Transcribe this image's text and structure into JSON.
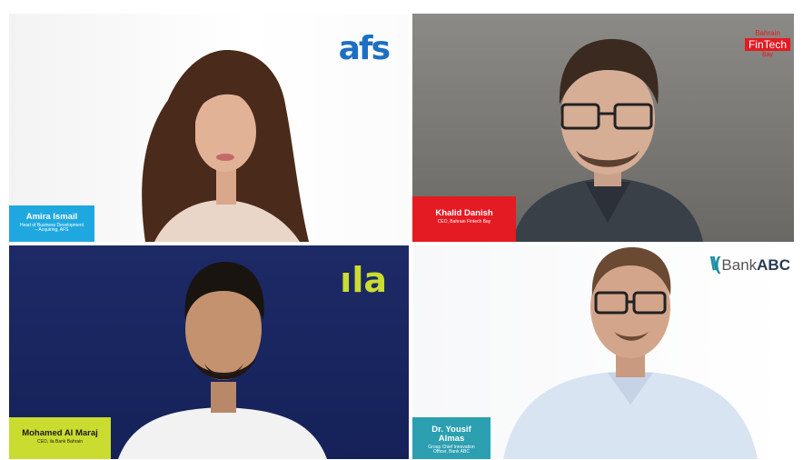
{
  "participants": [
    {
      "name": "Amira Ismail",
      "title": "Head of Business Development – Acquiring, AFS",
      "logo": "afs",
      "nameplate_color": "#1fa8e0"
    },
    {
      "name": "Khalid Danish",
      "title": "CEO, Bahrain Fintech Bay",
      "logo_lines": [
        "Bahrain",
        "FinTech",
        "Bay"
      ],
      "nameplate_color": "#e41b23"
    },
    {
      "name": "Mohamed Al Maraj",
      "title": "CEO, ila Bank Bahrain",
      "logo": "ila",
      "nameplate_color": "#c9dc2f"
    },
    {
      "name": "Dr. Yousif Almas",
      "title": "Group Chief Innovation Officer, Bank ABC",
      "logo_bank": "Bank",
      "logo_abc": "ABC",
      "nameplate_color": "#2c9fb1"
    }
  ]
}
